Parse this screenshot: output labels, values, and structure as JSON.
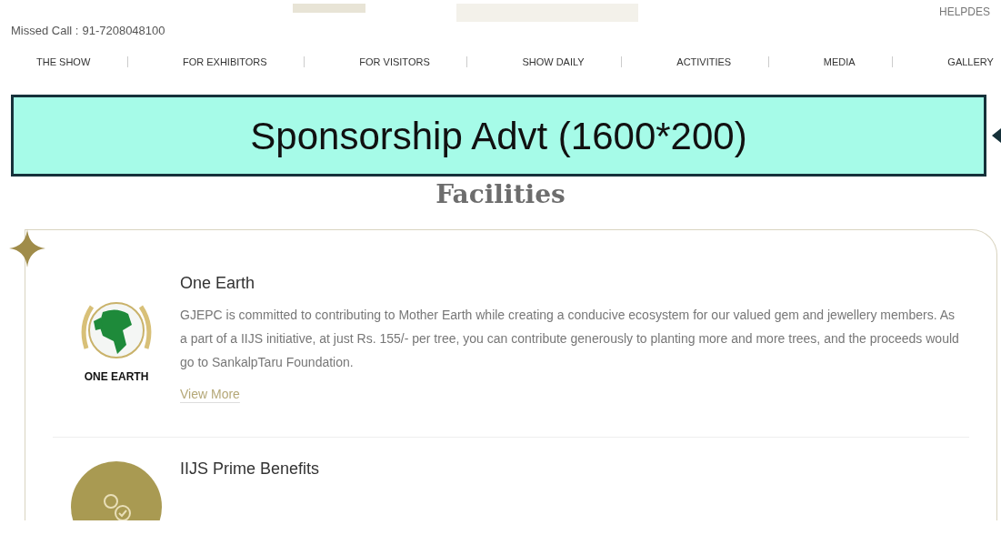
{
  "header": {
    "missed_call_label": "Missed Call :",
    "missed_call_number": "91-7208048100",
    "helpdesk": "HELPDES"
  },
  "nav": [
    {
      "label": "THE SHOW"
    },
    {
      "label": "FOR EXHIBITORS"
    },
    {
      "label": "FOR VISITORS"
    },
    {
      "label": "SHOW DAILY"
    },
    {
      "label": "ACTIVITIES"
    },
    {
      "label": "MEDIA"
    },
    {
      "label": "GALLERY"
    }
  ],
  "banner": {
    "text": "Sponsorship Advt (1600*200)"
  },
  "section_title": "Facilities",
  "facilities": [
    {
      "kind": "logo",
      "logo_text": "ONE EARTH",
      "title": "One Earth",
      "description": "GJEPC is committed to contributing to Mother Earth while creating a conducive ecosystem for our valued gem and jewellery members. As a part of a IIJS initiative, at just Rs. 155/- per tree, you can contribute generously to planting more and more trees, and the proceeds would go to SankalpTaru Foundation.",
      "link": "View More"
    },
    {
      "kind": "circle",
      "title": "IIJS Prime Benefits"
    }
  ]
}
